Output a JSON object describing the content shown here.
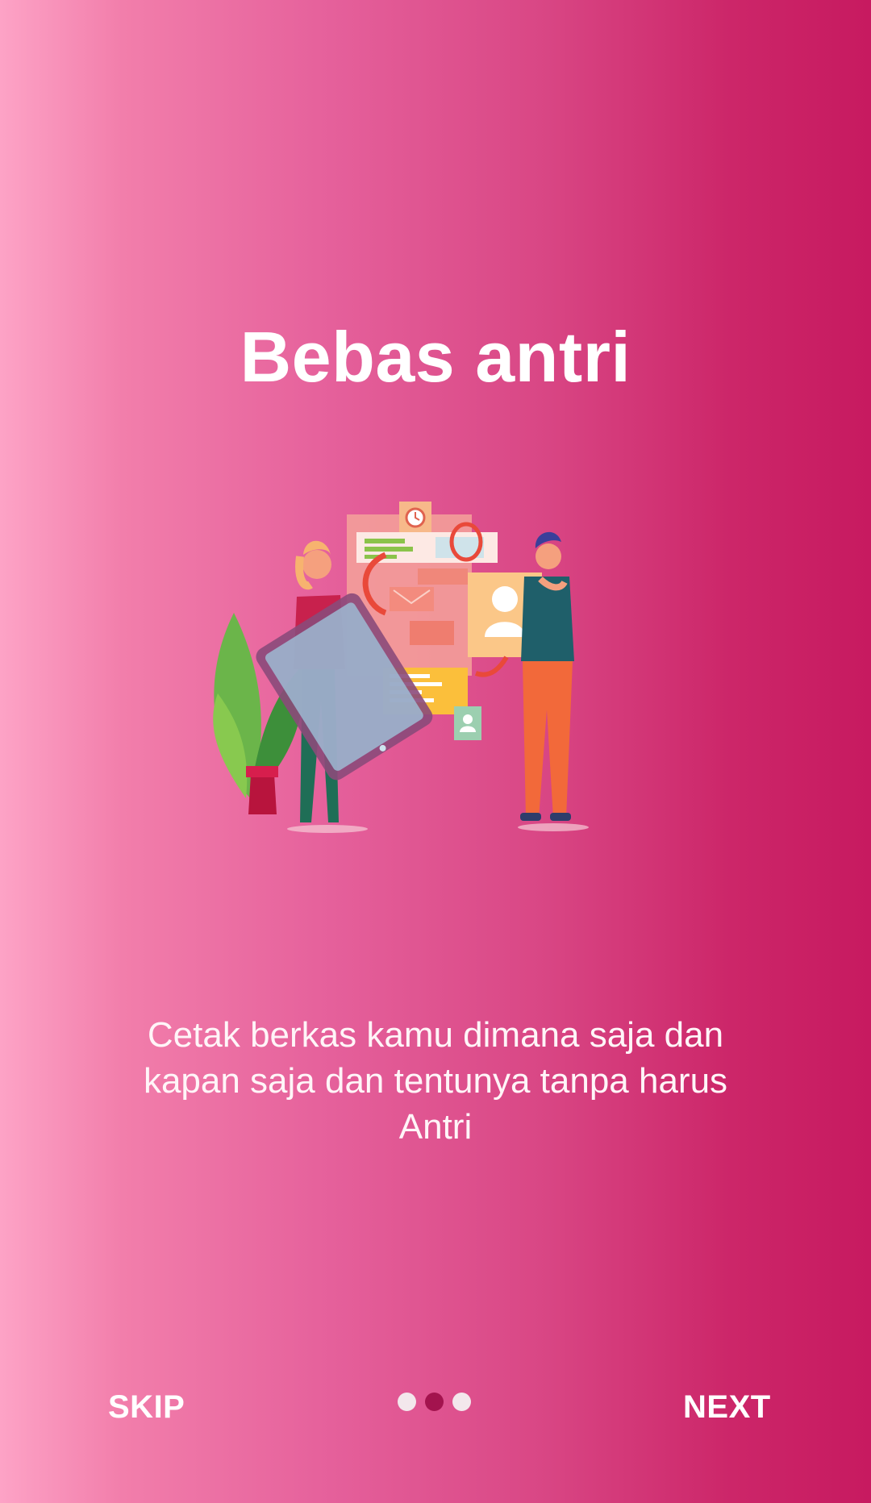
{
  "onboarding": {
    "title": "Bebas antri",
    "description": "Cetak berkas kamu dimana saja dan kapan saja dan tentunya tanpa harus Antri",
    "illustration_icon": "people-queue-illustration"
  },
  "footer": {
    "skip_label": "SKIP",
    "next_label": "NEXT",
    "page_indicator": {
      "total": 3,
      "current": 2
    }
  },
  "colors": {
    "gradient_start": "#fda3c6",
    "gradient_end": "#c71a60",
    "dot_inactive": "#f3e7ec",
    "dot_active": "#a3134e"
  }
}
